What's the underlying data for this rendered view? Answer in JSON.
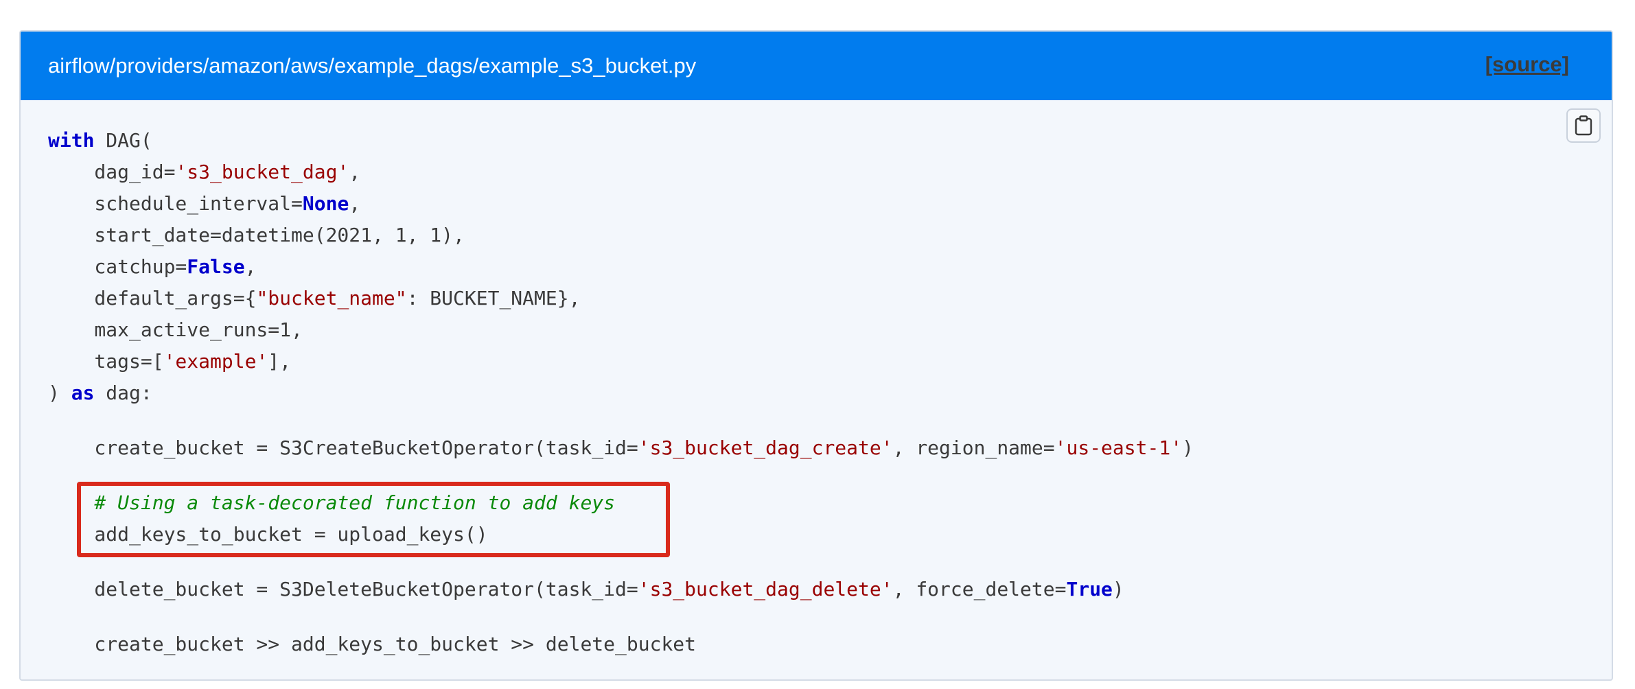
{
  "caption": {
    "path": "airflow/providers/amazon/aws/example_dags/example_s3_bucket.py",
    "source_link": "[source]"
  },
  "copy_button": {
    "icon": "clipboard-icon"
  },
  "code": {
    "l1_kw": "with",
    "l1_rest": " DAG(",
    "l2_pre": "    dag_id=",
    "l2_str": "'s3_bucket_dag'",
    "l2_post": ",",
    "l3_pre": "    schedule_interval=",
    "l3_kw": "None",
    "l3_post": ",",
    "l4": "    start_date=datetime(2021, 1, 1),",
    "l5_pre": "    catchup=",
    "l5_kw": "False",
    "l5_post": ",",
    "l6_pre": "    default_args={",
    "l6_str": "\"bucket_name\"",
    "l6_post": ": BUCKET_NAME},",
    "l7": "    max_active_runs=1,",
    "l8_pre": "    tags=[",
    "l8_str": "'example'",
    "l8_post": "],",
    "l9_pre": ") ",
    "l9_kw": "as",
    "l9_post": " dag:",
    "l10_pre": "    create_bucket = S3CreateBucketOperator(task_id=",
    "l10_str1": "'s3_bucket_dag_create'",
    "l10_mid": ", region_name=",
    "l10_str2": "'us-east-1'",
    "l10_post": ")",
    "l11_cmt": "    # Using a task-decorated function to add keys",
    "l12": "    add_keys_to_bucket = upload_keys()",
    "l13_pre": "    delete_bucket = S3DeleteBucketOperator(task_id=",
    "l13_str": "'s3_bucket_dag_delete'",
    "l13_mid": ", force_delete=",
    "l13_kw": "True",
    "l13_post": ")",
    "l14": "    create_bucket >> add_keys_to_bucket >> delete_bucket"
  },
  "colors": {
    "caption_bg": "#017cee",
    "code_bg": "#f3f7fc",
    "keyword": "#0000cc",
    "string": "#990000",
    "comment": "#0a8a0a",
    "highlight_border": "#d92a1c"
  }
}
